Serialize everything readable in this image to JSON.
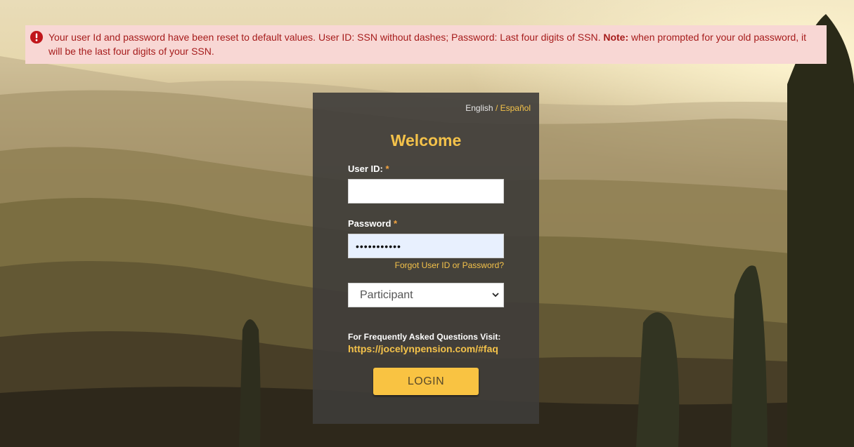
{
  "alert": {
    "message": "Your user Id and password have been reset to default values. User ID: SSN without dashes; Password: Last four digits of SSN. ",
    "note_label": "Note:",
    "note_text": " when prompted for your old password, it will be the last four digits of your SSN.",
    "icon": "exclamation-circle-icon",
    "color": "#a61c1c",
    "background": "#f8d7d4"
  },
  "language": {
    "current": "English",
    "separator": " / ",
    "alternate": "Español"
  },
  "login": {
    "title": "Welcome",
    "user_id_label": "User ID:",
    "password_label": "Password",
    "required_mark": "*",
    "user_id_value": "",
    "password_value": "•••••••••••",
    "forgot_link": "Forgot User ID or Password?",
    "role_selected": "Participant",
    "faq_label": "For Frequently Asked Questions Visit:",
    "faq_link": "https://jocelynpension.com/#faq",
    "login_button": "LOGIN"
  },
  "colors": {
    "accent": "#f4c24a",
    "button": "#f9c342",
    "card": "#3e3c3a"
  }
}
